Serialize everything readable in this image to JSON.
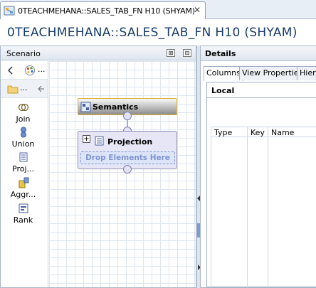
{
  "editor": {
    "tab_title": "0TEACHMEHANA::SALES_TAB_FN H10 (SHYAM)",
    "title": "0TEACHMEHANA::SALES_TAB_FN H10 (SHYAM)",
    "close_glyph": "✕"
  },
  "scenario": {
    "title": "Scenario",
    "expand_all_glyph": "⊞",
    "collapse_all_glyph": "⊟",
    "palette_overflow": "...",
    "palette_folder_overflow": "...",
    "palette": [
      {
        "label": "Join",
        "icon": "join-icon"
      },
      {
        "label": "Union",
        "icon": "union-icon"
      },
      {
        "label": "Proj...",
        "icon": "projection-icon"
      },
      {
        "label": "Aggr...",
        "icon": "aggregation-icon"
      },
      {
        "label": "Rank",
        "icon": "rank-icon"
      }
    ],
    "nodes": {
      "semantics": "Semantics",
      "projection": "Projection",
      "drop_hint": "Drop Elements Here",
      "expand_glyph": "+"
    }
  },
  "details": {
    "title": "Details",
    "tabs": [
      "Columns",
      "View Properties",
      "Hiera"
    ],
    "active_tab": 0,
    "section_title": "Local",
    "columns": [
      "Type",
      "Key",
      "Name"
    ]
  },
  "colors": {
    "title_text": "#173b6a",
    "semantics_border": "#e0b23a",
    "projection_fill": "#e6e6f6",
    "drop_hint_text": "#7d95d2"
  }
}
